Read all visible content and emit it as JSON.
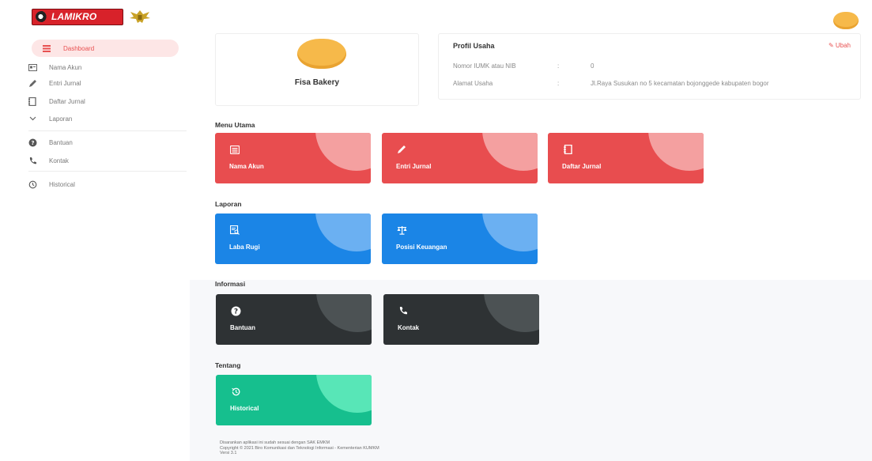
{
  "header": {
    "logo_text": "LAMIKRO"
  },
  "sidebar": {
    "items": [
      {
        "label": "Dashboard",
        "icon": "grid-list-icon",
        "active": true
      },
      {
        "label": "Nama Akun",
        "icon": "id-card-icon"
      },
      {
        "label": "Entri Jurnal",
        "icon": "pencil-icon"
      },
      {
        "label": "Daftar Jurnal",
        "icon": "book-icon"
      },
      {
        "label": "Laporan",
        "icon": "chevron-down-icon"
      },
      {
        "label": "Bantuan",
        "icon": "help-circle-icon"
      },
      {
        "label": "Kontak",
        "icon": "phone-icon"
      },
      {
        "label": "Historical",
        "icon": "history-icon"
      }
    ]
  },
  "profile": {
    "name": "Fisa Bakery"
  },
  "info": {
    "title": "Profil Usaha",
    "edit_label": "Ubah",
    "rows": [
      {
        "label": "Nomor IUMK atau NIB",
        "sep": ":",
        "value": "0"
      },
      {
        "label": "Alamat Usaha",
        "sep": ":",
        "value": "Jl.Raya Susukan no 5 kecamatan bojonggede kabupaten bogor"
      }
    ]
  },
  "sections": {
    "menu_utama": "Menu Utama",
    "laporan": "Laporan",
    "informasi": "Informasi",
    "tentang": "Tentang"
  },
  "tiles": {
    "nama_akun": "Nama Akun",
    "entri_jurnal": "Entri Jurnal",
    "daftar_jurnal": "Daftar Jurnal",
    "laba_rugi": "Laba Rugi",
    "posisi_keuangan": "Posisi Keuangan",
    "bantuan": "Bantuan",
    "kontak": "Kontak",
    "historical": "Historical"
  },
  "footer": {
    "line1": "Disarankan aplikasi ini sudah sesuai dengan SAK EMKM",
    "line2": "Copyright © 2021 Biro Komunikasi dan Teknologi Informasi - Kementerian KUMKM",
    "line3": "Versi 3.1"
  },
  "colors": {
    "red": "#e84d4f",
    "blue": "#1b85e6",
    "dark": "#2e3234",
    "green": "#16bf8e",
    "accent": "#e85151"
  }
}
